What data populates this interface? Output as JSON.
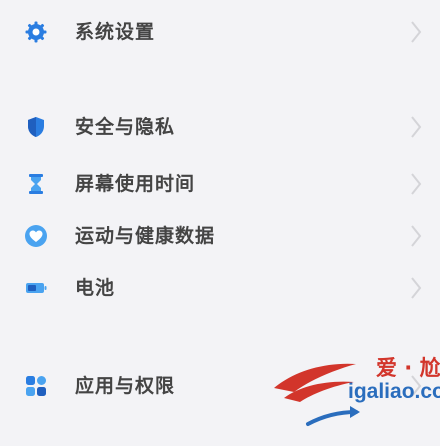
{
  "settings": {
    "items": [
      {
        "label": "系统设置",
        "icon": "gear-icon"
      },
      {
        "label": "安全与隐私",
        "icon": "shield-icon"
      },
      {
        "label": "屏幕使用时间",
        "icon": "hourglass-icon"
      },
      {
        "label": "运动与健康数据",
        "icon": "heart-icon"
      },
      {
        "label": "电池",
        "icon": "battery-icon"
      },
      {
        "label": "应用与权限",
        "icon": "apps-grid-icon"
      }
    ]
  },
  "watermark": {
    "cn": "爱 · 尬聊",
    "en": "igaliao.com"
  },
  "colors": {
    "background": "#f3f3f6",
    "icon_blue": "#2a7de1",
    "icon_dark_blue": "#1f5fbf",
    "icon_light_blue": "#4aa3f0",
    "chevron": "#d4d4d8",
    "watermark_red": "#d2352b",
    "watermark_blue": "#2a6dbd"
  }
}
